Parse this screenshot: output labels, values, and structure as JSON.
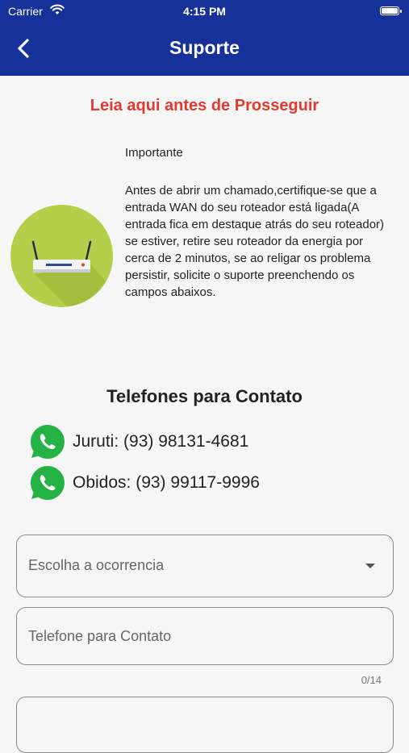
{
  "status_bar": {
    "carrier": "Carrier",
    "time": "4:15 PM"
  },
  "appbar": {
    "title": "Suporte"
  },
  "notice": {
    "heading": "Leia aqui antes de Prosseguir",
    "important_label": "Importante",
    "body": "Antes de abrir um chamado,certifique-se que a entrada WAN do seu roteador está ligada(A entrada fica em destaque atrás do seu roteador) se estiver, retire seu roteador da energia por cerca de 2 minutos, se ao religar os problema persistir, solicite o suporte preenchendo os campos abaixos."
  },
  "contacts": {
    "title": "Telefones para Contato",
    "items": [
      {
        "label": "Juruti: (93) 98131-4681"
      },
      {
        "label": "Obidos: (93) 99117-9996"
      }
    ]
  },
  "form": {
    "occurrence_placeholder": "Escolha a ocorrencia",
    "phone_placeholder": "Telefone para Contato",
    "phone_counter": "0/14"
  },
  "colors": {
    "appbar": "#17319a",
    "warning": "#e23a2e",
    "whatsapp": "#25b245",
    "router_bg": "#b5cf4a"
  },
  "icons": [
    "back-arrow-icon",
    "wifi-icon",
    "battery-icon",
    "router-icon",
    "whatsapp-icon",
    "dropdown-caret-icon"
  ]
}
